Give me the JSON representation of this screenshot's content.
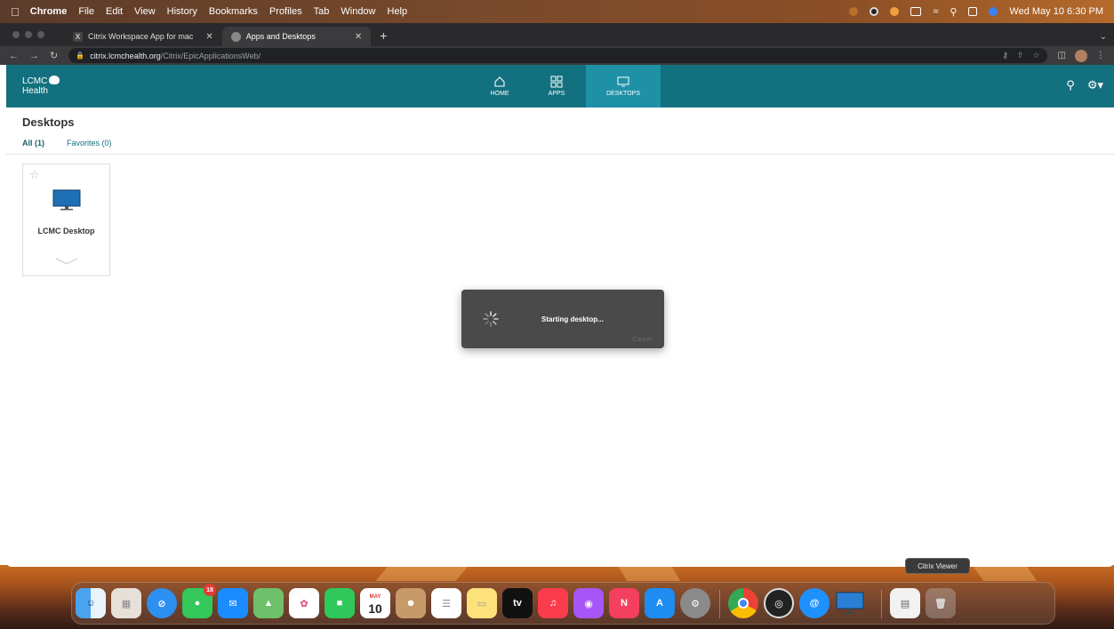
{
  "menubar": {
    "app": "Chrome",
    "items": [
      "File",
      "Edit",
      "View",
      "History",
      "Bookmarks",
      "Profiles",
      "Tab",
      "Window",
      "Help"
    ],
    "clock": "Wed May 10  6:30 PM"
  },
  "tabs": [
    {
      "title": "Citrix Workspace App for mac",
      "favicon": "citrix-x-icon"
    },
    {
      "title": "Apps and Desktops",
      "favicon": "citrix-favicon"
    }
  ],
  "address": {
    "host": "citrix.lcmchealth.org",
    "path": "/Citrix/EpicApplicationsWeb/"
  },
  "citrix": {
    "logo_line1": "LCMC",
    "logo_line2": "Health",
    "nav": [
      {
        "label": "HOME",
        "icon": "home-icon"
      },
      {
        "label": "APPS",
        "icon": "apps-grid-icon"
      },
      {
        "label": "DESKTOPS",
        "icon": "monitor-icon",
        "active": true
      }
    ],
    "accent": "#13707f"
  },
  "page": {
    "title": "Desktops",
    "filters": {
      "all": "All (1)",
      "favorites": "Favorites (0)"
    }
  },
  "tile": {
    "name": "LCMC Desktop"
  },
  "dialog": {
    "message": "Starting desktop...",
    "cancel": "Cancel"
  },
  "dock": {
    "tooltip": "Citrix Viewer",
    "messages_badge": "18",
    "calendar_month": "MAY",
    "calendar_day": "10",
    "tv_label": "tv"
  }
}
